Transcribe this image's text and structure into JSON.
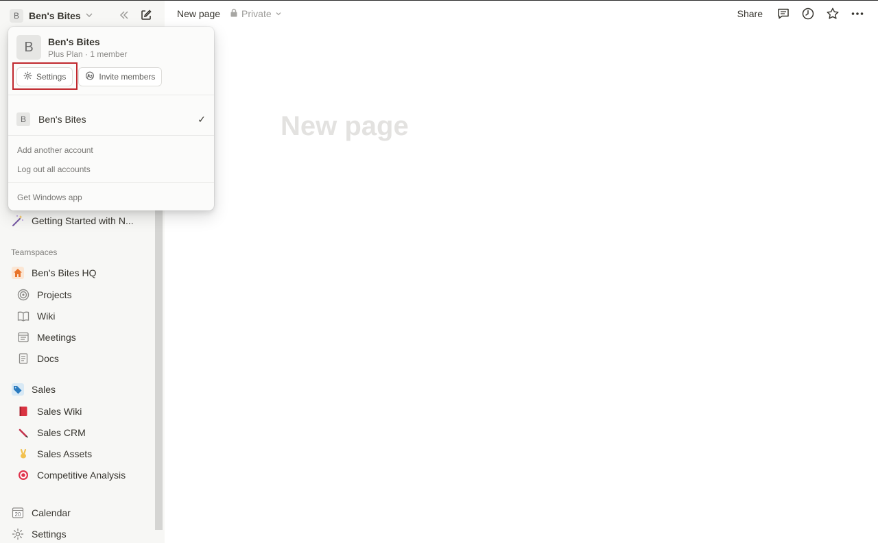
{
  "workspace": {
    "initial": "B",
    "name": "Ben's Bites"
  },
  "sidebar": {
    "getting_started": "Getting Started with N...",
    "teamspaces_heading": "Teamspaces",
    "teamspaces": [
      {
        "label": "Ben's Bites HQ",
        "icon": "house-icon"
      },
      {
        "label": "Projects",
        "icon": "target-icon"
      },
      {
        "label": "Wiki",
        "icon": "book-icon"
      },
      {
        "label": "Meetings",
        "icon": "calendar-list-icon"
      },
      {
        "label": "Docs",
        "icon": "document-icon"
      },
      {
        "label": "Sales",
        "icon": "tag-icon"
      },
      {
        "label": "Sales Wiki",
        "icon": "red-book-icon"
      },
      {
        "label": "Sales CRM",
        "icon": "pen-icon"
      },
      {
        "label": "Sales Assets",
        "icon": "victory-hand-icon"
      },
      {
        "label": "Competitive Analysis",
        "icon": "bullseye-icon"
      }
    ],
    "calendar": "Calendar",
    "calendar_day": "20",
    "settings": "Settings"
  },
  "topbar": {
    "page_name": "New page",
    "privacy": "Private",
    "share": "Share"
  },
  "page": {
    "title_placeholder": "New page"
  },
  "dropdown": {
    "workspace_name": "Ben's Bites",
    "plan": "Plus Plan · 1 member",
    "settings_button": "Settings",
    "invite_button": "Invite members",
    "account_name": "Ben's Bites",
    "check": "✓",
    "add_account": "Add another account",
    "logout": "Log out all accounts",
    "windows_app": "Get Windows app"
  },
  "colors": {
    "highlight": "#c0272d",
    "sidebar_bg": "#f7f7f5",
    "title_placeholder": "#e3e2e0"
  }
}
